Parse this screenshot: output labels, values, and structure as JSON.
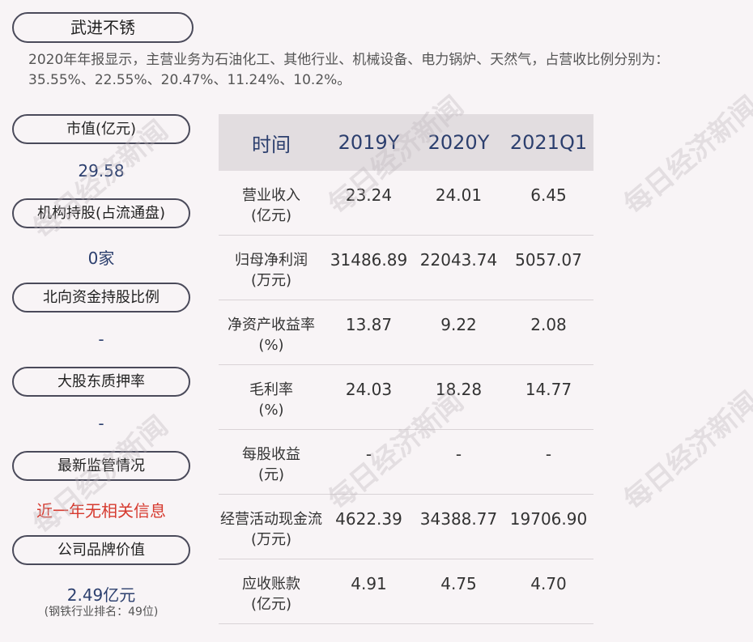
{
  "company_name": "武进不锈",
  "summary": "2020年年报显示，主营业务为石油化工、其他行业、机械设备、电力锅炉、天然气，占营收比例分别为：35.55%、22.55%、20.47%、11.24%、10.2%。",
  "sidebar": {
    "market_cap_label": "市值(亿元)",
    "market_cap_value": "29.58",
    "institution_label": "机构持股(占流通盘)",
    "institution_value": "0家",
    "northbound_label": "北向资金持股比例",
    "northbound_value": "-",
    "pledge_label": "大股东质押率",
    "pledge_value": "-",
    "regulation_label": "最新监管情况",
    "regulation_value": "近一年无相关信息",
    "brand_label": "公司品牌价值",
    "brand_value": "2.49亿元",
    "brand_note": "(钢铁行业排名：49位)"
  },
  "table": {
    "headers": [
      "时间",
      "2019Y",
      "2020Y",
      "2021Q1"
    ],
    "rows": [
      {
        "label1": "营业收入",
        "label2": "(亿元)",
        "values": [
          "23.24",
          "24.01",
          "6.45"
        ]
      },
      {
        "label1": "归母净利润",
        "label2": "(万元)",
        "values": [
          "31486.89",
          "22043.74",
          "5057.07"
        ]
      },
      {
        "label1": "净资产收益率",
        "label2": "(%)",
        "values": [
          "13.87",
          "9.22",
          "2.08"
        ]
      },
      {
        "label1": "毛利率",
        "label2": "(%)",
        "values": [
          "24.03",
          "18.28",
          "14.77"
        ]
      },
      {
        "label1": "每股收益",
        "label2": "(元)",
        "values": [
          "-",
          "-",
          "-"
        ]
      },
      {
        "label1": "经营活动现金流",
        "label2": "(万元)",
        "values": [
          "4622.39",
          "34388.77",
          "19706.90"
        ]
      },
      {
        "label1": "应收账款",
        "label2": "(亿元)",
        "values": [
          "4.91",
          "4.75",
          "4.70"
        ]
      }
    ]
  },
  "watermark": "每日经济新闻"
}
